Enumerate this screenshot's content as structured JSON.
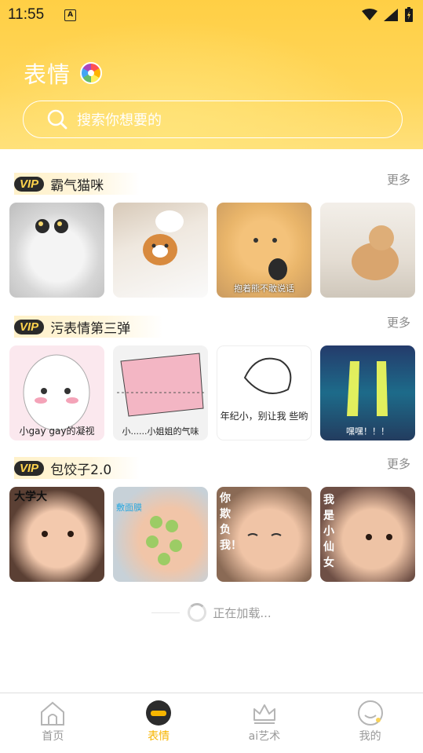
{
  "status_bar": {
    "time": "11:55",
    "notif_icon": "A"
  },
  "header": {
    "title": "表情",
    "search_placeholder": "搜索你想要的"
  },
  "sections": [
    {
      "badge": "VIP",
      "title": "霸气猫咪",
      "more": "更多",
      "thumbs": [
        {
          "caption": ""
        },
        {
          "caption": ""
        },
        {
          "caption": "抱着熊不敢说话"
        },
        {
          "caption": ""
        }
      ]
    },
    {
      "badge": "VIP",
      "title": "污表情第三弹",
      "more": "更多",
      "thumbs": [
        {
          "caption": "小gay gay的凝视"
        },
        {
          "caption": "小......小姐姐的气味"
        },
        {
          "caption": "年纪小，别让我 些哟"
        },
        {
          "caption": "嘿嘿！！！"
        }
      ]
    },
    {
      "badge": "VIP",
      "title": "包饺子2.0",
      "more": "更多",
      "thumbs": [
        {
          "caption": "大学大"
        },
        {
          "caption": "敷面膜"
        },
        {
          "caption": "你欺负我！"
        },
        {
          "caption": "我是小仙女"
        }
      ]
    }
  ],
  "loading_text": "正在加载...",
  "tabs": [
    {
      "label": "首页",
      "icon": "home-icon"
    },
    {
      "label": "表情",
      "icon": "emoji-icon"
    },
    {
      "label": "ai艺术",
      "icon": "crown-icon"
    },
    {
      "label": "我的",
      "icon": "profile-icon"
    }
  ],
  "colors": {
    "accent": "#f7b500",
    "header": "#ffd24f",
    "vip_bg": "#2a2a2a",
    "vip_text": "#ffd34d"
  }
}
